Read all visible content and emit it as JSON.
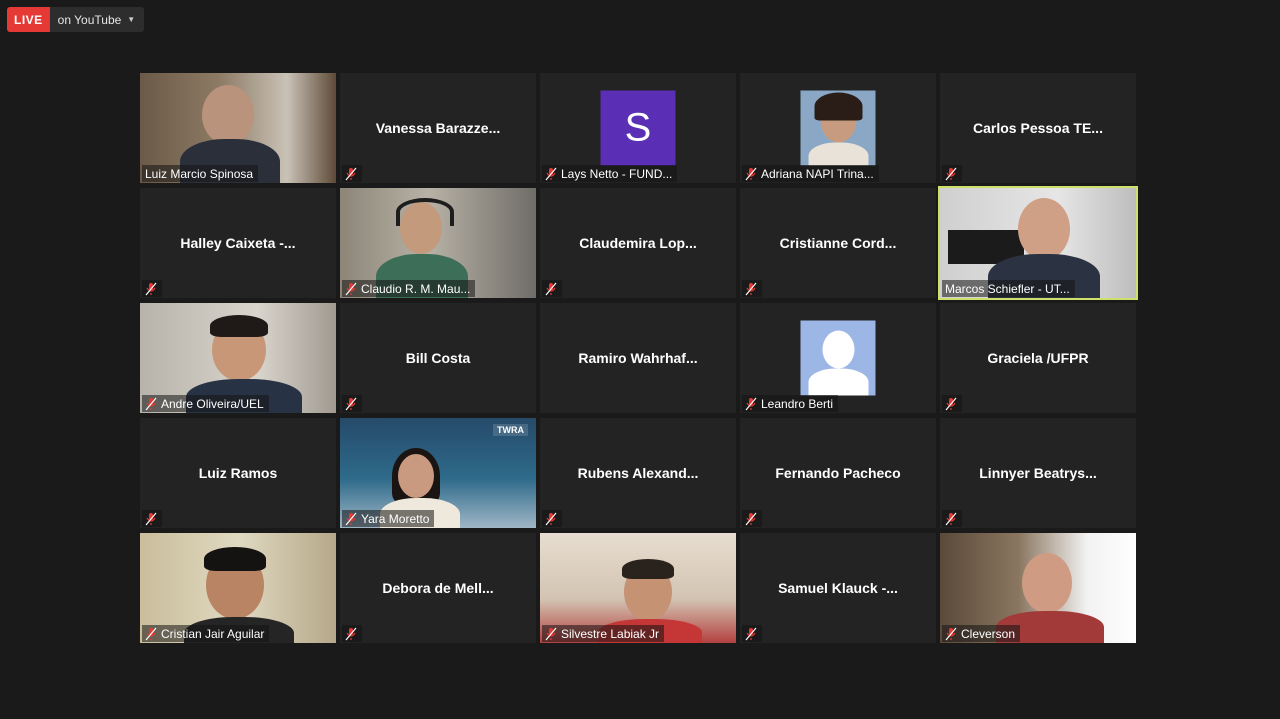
{
  "stream": {
    "live_label": "LIVE",
    "target_label": "on YouTube"
  },
  "participants": [
    {
      "name": "Luiz Marcio Spinosa",
      "video": true
    },
    {
      "name": "Vanessa  Barazze...",
      "video": false
    },
    {
      "name": "Lays Netto - FUND...",
      "video": false,
      "avatar_letter": "S"
    },
    {
      "name": "Adriana NAPI Trina...",
      "video": false
    },
    {
      "name": "Carlos Pessoa TE...",
      "video": false
    },
    {
      "name": "Halley  Caixeta  -...",
      "video": false
    },
    {
      "name": "Claudio R. M. Mau...",
      "video": true
    },
    {
      "name": "Claudemira  Lop...",
      "video": false
    },
    {
      "name": "Cristianne  Cord...",
      "video": false
    },
    {
      "name": "Marcos Schiefler - UT...",
      "video": true,
      "active_speaker": true
    },
    {
      "name": "Andre Oliveira/UEL",
      "video": true
    },
    {
      "name": "Bill Costa",
      "video": false
    },
    {
      "name": "Ramiro  Wahrhaf...",
      "video": false
    },
    {
      "name": "Leandro Berti",
      "video": false
    },
    {
      "name": "Graciela /UFPR",
      "video": false
    },
    {
      "name": "Luiz Ramos",
      "video": false
    },
    {
      "name": "Yara Moretto",
      "video": true
    },
    {
      "name": "Rubens  Alexand...",
      "video": false
    },
    {
      "name": "Fernando Pacheco",
      "video": false
    },
    {
      "name": "Linnyer  Beatrys...",
      "video": false
    },
    {
      "name": "Cristian Jair Aguilar",
      "video": true
    },
    {
      "name": "Debora  de  Mell...",
      "video": false
    },
    {
      "name": "Silvestre Labiak Jr",
      "video": true
    },
    {
      "name": "Samuel  Klauck  -...",
      "video": false
    },
    {
      "name": "Cleverson",
      "video": true
    }
  ],
  "logo_text": "TWRA",
  "colors": {
    "live_red": "#e53935",
    "active_border": "#cfe06a",
    "muted_mic": "#e53935"
  }
}
